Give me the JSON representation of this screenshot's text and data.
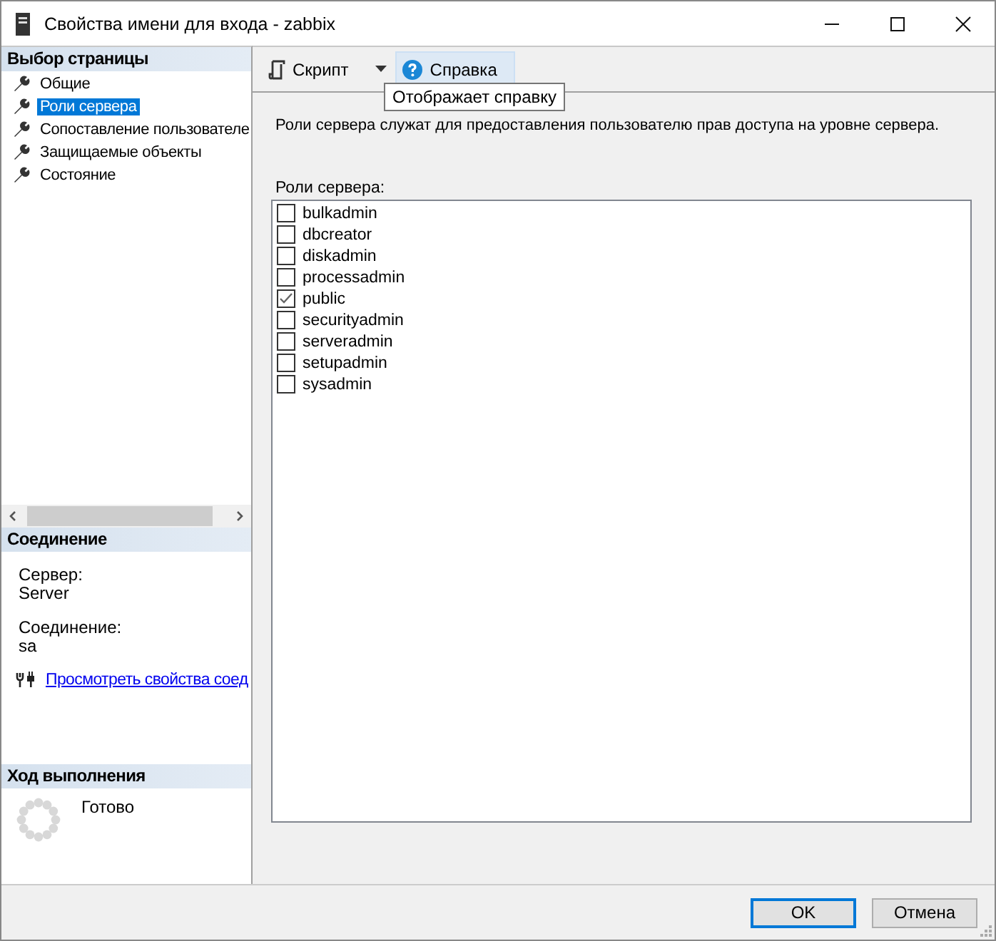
{
  "window": {
    "title": "Свойства имени для входа - zabbix"
  },
  "page_select": {
    "header": "Выбор страницы",
    "items": [
      {
        "label": "Общие",
        "selected": false
      },
      {
        "label": "Роли сервера",
        "selected": true
      },
      {
        "label": "Сопоставление пользователе",
        "selected": false
      },
      {
        "label": "Защищаемые объекты",
        "selected": false
      },
      {
        "label": "Состояние",
        "selected": false
      }
    ]
  },
  "connection": {
    "header": "Соединение",
    "fields": [
      {
        "label": "Сервер:",
        "value": "Server"
      },
      {
        "label": "Соединение:",
        "value": "sa"
      }
    ],
    "link": "Просмотреть свойства соед"
  },
  "progress": {
    "header": "Ход выполнения",
    "status": "Готово"
  },
  "toolbar": {
    "script_button": "Скрипт",
    "help_button": "Справка",
    "tooltip": "Отображает справку"
  },
  "description": "Роли сервера служат для предоставления пользователю прав доступа на уровне сервера.",
  "roles_label": "Роли сервера:",
  "roles": [
    {
      "name": "bulkadmin",
      "checked": false
    },
    {
      "name": "dbcreator",
      "checked": false
    },
    {
      "name": "diskadmin",
      "checked": false
    },
    {
      "name": "processadmin",
      "checked": false
    },
    {
      "name": "public",
      "checked": true
    },
    {
      "name": "securityadmin",
      "checked": false
    },
    {
      "name": "serveradmin",
      "checked": false
    },
    {
      "name": "setupadmin",
      "checked": false
    },
    {
      "name": "sysadmin",
      "checked": false
    }
  ],
  "buttons": [
    {
      "label": "OK",
      "default": true
    },
    {
      "label": "Отмена",
      "default": false
    }
  ]
}
